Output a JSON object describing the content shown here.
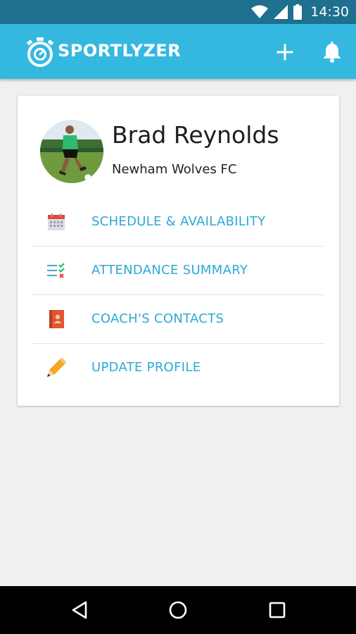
{
  "status_bar": {
    "time": "14:30"
  },
  "app_bar": {
    "brand": "SPORTLYZER"
  },
  "profile": {
    "name": "Brad Reynolds",
    "team": "Newham Wolves FC"
  },
  "menu": [
    {
      "label": "SCHEDULE & AVAILABILITY",
      "icon": "calendar-icon"
    },
    {
      "label": "ATTENDANCE SUMMARY",
      "icon": "attendance-list-icon"
    },
    {
      "label": "COACH'S CONTACTS",
      "icon": "contacts-book-icon"
    },
    {
      "label": "UPDATE PROFILE",
      "icon": "pencil-icon"
    }
  ],
  "colors": {
    "status_bar": "#1f6f8e",
    "app_bar": "#35b8e0",
    "menu_text": "#2ea9d6",
    "background": "#eef0f2"
  }
}
